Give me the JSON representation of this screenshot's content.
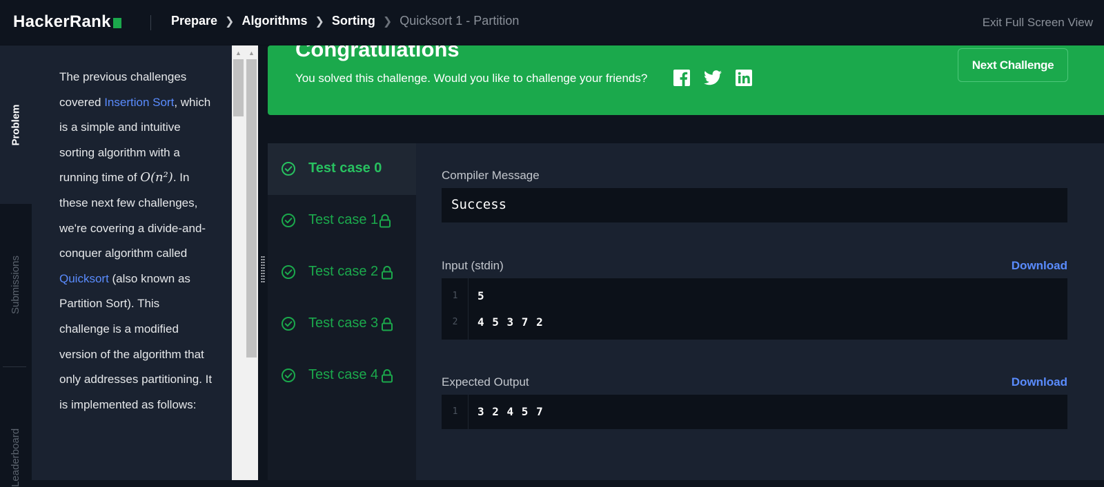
{
  "header": {
    "logo_text": "HackerRank",
    "breadcrumb": [
      "Prepare",
      "Algorithms",
      "Sorting",
      "Quicksort 1 - Partition"
    ],
    "exit_label": "Exit Full Screen View"
  },
  "side_tabs": {
    "problem": "Problem",
    "submissions": "Submissions",
    "leaderboard": "Leaderboard"
  },
  "problem": {
    "p1": "The previous challenges covered ",
    "link1": "Insertion Sort",
    "p2": ", which is a simple and intuitive sorting algorithm with a running time of ",
    "math": "O(n²)",
    "p3": ". In these next few challenges, we're covering a divide-and-conquer algorithm called ",
    "link2": "Quicksort",
    "p4": " (also known as Partition Sort). This challenge is a modified version of the algorithm that only addresses partitioning. It is implemented as follows:"
  },
  "banner": {
    "title": "Congratulations",
    "message": "You solved this challenge. Would you like to challenge your friends?",
    "next_label": "Next Challenge",
    "social_icons": [
      "facebook-icon",
      "twitter-icon",
      "linkedin-icon"
    ]
  },
  "test_cases": [
    {
      "label": "Test case 0",
      "locked": false,
      "active": true
    },
    {
      "label": "Test case 1",
      "locked": true,
      "active": false
    },
    {
      "label": "Test case 2",
      "locked": true,
      "active": false
    },
    {
      "label": "Test case 3",
      "locked": true,
      "active": false
    },
    {
      "label": "Test case 4",
      "locked": true,
      "active": false
    }
  ],
  "detail": {
    "compiler_label": "Compiler Message",
    "compiler_message": "Success",
    "input_label": "Input (stdin)",
    "download_label": "Download",
    "input_lines": [
      {
        "n": "1",
        "text": "5"
      },
      {
        "n": "2",
        "text": "4 5 3 7 2"
      }
    ],
    "expected_label": "Expected Output",
    "expected_lines": [
      {
        "n": "1",
        "text": "3 2 4 5 7"
      }
    ]
  },
  "colors": {
    "accent_green": "#1ba94c",
    "link_blue": "#5a8cff",
    "background": "#0e141e",
    "panel": "#1a2230"
  }
}
